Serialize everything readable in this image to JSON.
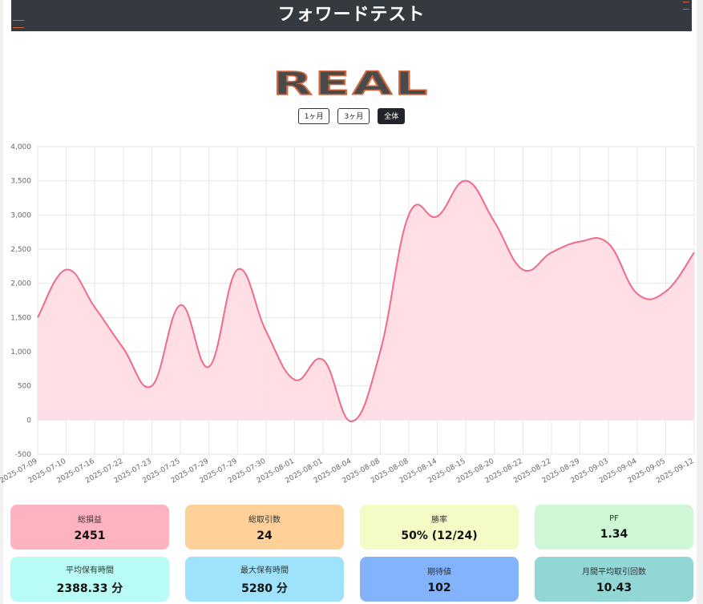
{
  "header": {
    "title": "フォワードテスト"
  },
  "logo": {
    "text": "REAL"
  },
  "range_buttons": [
    {
      "label": "1ヶ月",
      "active": false
    },
    {
      "label": "3ヶ月",
      "active": false
    },
    {
      "label": "全体",
      "active": true
    }
  ],
  "chart_data": {
    "type": "area",
    "title": "",
    "xlabel": "",
    "ylabel": "",
    "ylim": [
      -500,
      4000
    ],
    "yticks": [
      -500,
      0,
      500,
      1000,
      1500,
      2000,
      2500,
      3000,
      3500,
      4000
    ],
    "ytick_labels": [
      "-500",
      "0",
      "500",
      "1,000",
      "1,500",
      "2,000",
      "2,500",
      "3,000",
      "3,500",
      "4,000"
    ],
    "grid": true,
    "legend": "none",
    "line_color": "#f06a8a",
    "fill_color": "#ffdde4",
    "categories": [
      "2025-07-09",
      "2025-07-10",
      "2025-07-16",
      "2025-07-22",
      "2025-07-23",
      "2025-07-25",
      "2025-07-29",
      "2025-07-29",
      "2025-07-30",
      "2025-08-01",
      "2025-08-01",
      "2025-08-04",
      "2025-08-08",
      "2025-08-08",
      "2025-08-14",
      "2025-08-15",
      "2025-08-20",
      "2025-08-22",
      "2025-08-22",
      "2025-08-29",
      "2025-09-03",
      "2025-09-04",
      "2025-09-05",
      "2025-09-12"
    ],
    "values": [
      1500,
      2200,
      1650,
      1050,
      500,
      1680,
      780,
      2200,
      1300,
      590,
      880,
      -20,
      1000,
      3000,
      2980,
      3500,
      2900,
      2200,
      2450,
      2610,
      2580,
      1850,
      1880,
      2451
    ]
  },
  "stats": [
    {
      "label": "総損益",
      "value": "2451",
      "color": "#ffb3c1"
    },
    {
      "label": "総取引数",
      "value": "24",
      "color": "#ffd199"
    },
    {
      "label": "勝率",
      "value": "50% (12/24)",
      "color": "#f5fbc4"
    },
    {
      "label": "PF",
      "value": "1.34",
      "color": "#cff7d6"
    },
    {
      "label": "平均保有時間",
      "value": "2388.33 分",
      "color": "#b8fcf5"
    },
    {
      "label": "最大保有時間",
      "value": "5280 分",
      "color": "#9ee3fb"
    },
    {
      "label": "期待値",
      "value": "102",
      "color": "#82b3fb"
    },
    {
      "label": "月間平均取引回数",
      "value": "10.43",
      "color": "#92d6d6"
    }
  ]
}
